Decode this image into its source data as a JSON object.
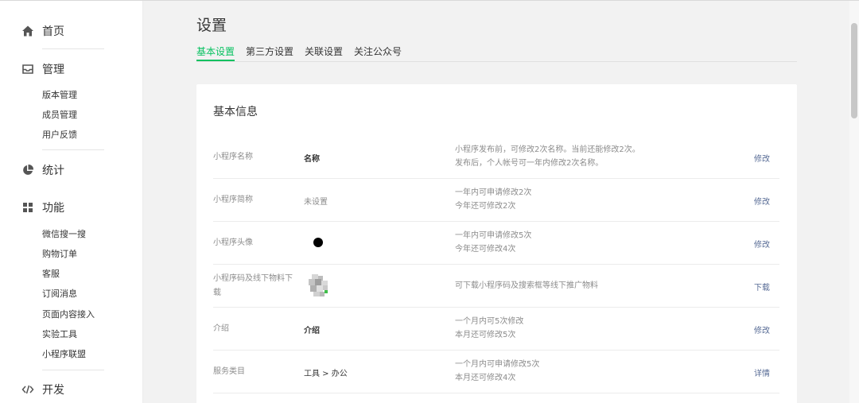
{
  "sidebar": {
    "home": {
      "label": "首页",
      "icon": "home-icon"
    },
    "manage": {
      "label": "管理",
      "icon": "inbox-icon",
      "items": [
        "版本管理",
        "成员管理",
        "用户反馈"
      ]
    },
    "stats": {
      "label": "统计",
      "icon": "pie-chart-icon"
    },
    "features": {
      "label": "功能",
      "icon": "grid-icon",
      "items": [
        "微信搜一搜",
        "购物订单",
        "客服",
        "订阅消息",
        "页面内容接入",
        "实验工具",
        "小程序联盟"
      ]
    },
    "dev": {
      "label": "开发",
      "icon": "code-icon"
    }
  },
  "page": {
    "title": "设置",
    "tabs": [
      {
        "label": "基本设置",
        "active": true
      },
      {
        "label": "第三方设置",
        "active": false
      },
      {
        "label": "关联设置",
        "active": false
      },
      {
        "label": "关注公众号",
        "active": false
      }
    ]
  },
  "card": {
    "title": "基本信息",
    "rows": [
      {
        "label": "小程序名称",
        "value": "名称",
        "desc1": "小程序发布前，可修改2次名称。当前还能修改2次。",
        "desc2": "发布后，个人帐号可一年内修改2次名称。",
        "action": "修改"
      },
      {
        "label": "小程序简称",
        "value": "未设置",
        "desc1": "一年内可申请修改2次",
        "desc2": "今年还可修改2次",
        "action": "修改"
      },
      {
        "label": "小程序头像",
        "value": "",
        "desc1": "一年内可申请修改5次",
        "desc2": "今年还可修改4次",
        "action": "修改"
      },
      {
        "label1": "小程序码及线下物料下",
        "label2": "载",
        "value": "",
        "desc1": "可下载小程序码及搜索框等线下推广物料",
        "desc2": "",
        "action": "下载"
      },
      {
        "label": "介绍",
        "value": "介绍",
        "desc1": "一个月内可5次修改",
        "desc2": "本月还可修改5次",
        "action": "修改"
      },
      {
        "label": "服务类目",
        "value": "工具 > 办公",
        "desc1": "一个月内可申请修改5次",
        "desc2": "本月还可修改4次",
        "action": "详情"
      }
    ]
  },
  "colors": {
    "accent": "#07c160",
    "link": "#576b95"
  }
}
